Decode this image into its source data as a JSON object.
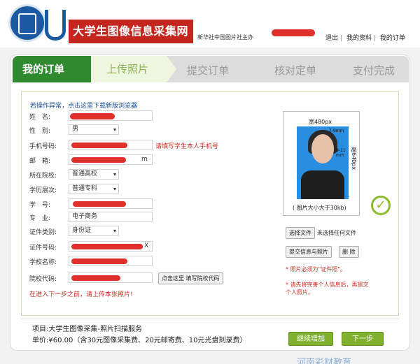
{
  "header": {
    "title": "大学生图像信息采集网",
    "sponsor": "新华社中国图片社主办",
    "links": [
      "退出",
      "我的资料",
      "我的订单"
    ]
  },
  "steps": {
    "my_order": "我的订单",
    "upload": "上传照片",
    "submit": "提交订单",
    "verify": "核对定单",
    "pay": "支付完成"
  },
  "form": {
    "warning": "若操作异常，点击这里下载新版浏览器",
    "name_label": "姓　名:",
    "gender_label": "性　别:",
    "gender_value": "男",
    "phone_label": "手机号码:",
    "phone_hint": "请填写学生本人手机号",
    "email_label": "邮　箱:",
    "email_suffix": "m",
    "region_label": "所在院校:",
    "region_value": "普通高校",
    "level_label": "学历层次:",
    "level_value": "普通专科",
    "student_no_label": "学　号:",
    "major_label": "专　业:",
    "major_value": "电子商务",
    "id_type_label": "证件类别:",
    "id_type_value": "身份证",
    "id_no_label": "证件号码:",
    "id_suffix": "X",
    "school_label": "学校名称:",
    "school_code_label": "院校代码:",
    "school_code_btn": "点击这里 填写院校代码",
    "bottom_warning": "在进入下一步之前，请上传本张照片!"
  },
  "photo": {
    "width_label": "宽480px",
    "height_label": "高640px",
    "top_gap": "7-9mm",
    "side_gap": "9-11 mm",
    "size_note": "( 图片大小大于30kb)",
    "choose_btn": "选择文件",
    "no_file": "未选择任何文件",
    "submit_btn": "提交信息与照片",
    "delete_btn": "删 除",
    "note1": "* 照片必须为\"证件照\"。",
    "note2": "* 请先将完善个人信息后，再提交个人照片。"
  },
  "footer": {
    "item": "项目:大学生图像采集-照片扫描服务",
    "price": "单价:¥60.00（含30元图像采集费、20元邮寄费、10元光盘刻录费）",
    "continue_btn": "继续增加",
    "next_btn": "下一步"
  },
  "watermark": "河南彩财教育"
}
